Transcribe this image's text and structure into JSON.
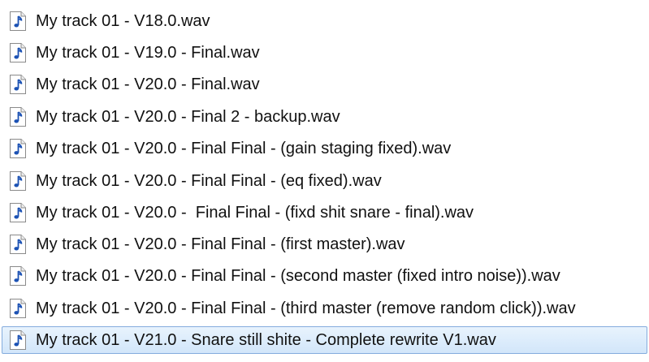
{
  "file_list": {
    "icon": "audio-file-icon",
    "colors": {
      "icon_note": "#1c52b4",
      "selection_fill": "#d9eafb",
      "selection_border": "#84acdd"
    },
    "items": [
      {
        "name": "My track 01 - V18.0.wav",
        "selected": false
      },
      {
        "name": "My track 01 - V19.0 - Final.wav",
        "selected": false
      },
      {
        "name": "My track 01 - V20.0 - Final.wav",
        "selected": false
      },
      {
        "name": "My track 01 - V20.0 - Final 2 - backup.wav",
        "selected": false
      },
      {
        "name": "My track 01 - V20.0 - Final Final - (gain staging fixed).wav",
        "selected": false
      },
      {
        "name": "My track 01 - V20.0 - Final Final - (eq fixed).wav",
        "selected": false
      },
      {
        "name": "My track 01 - V20.0 -  Final Final - (fixd shit snare - final).wav",
        "selected": false
      },
      {
        "name": "My track 01 - V20.0 - Final Final - (first master).wav",
        "selected": false
      },
      {
        "name": "My track 01 - V20.0 - Final Final - (second master (fixed intro noise)).wav",
        "selected": false
      },
      {
        "name": "My track 01 - V20.0 - Final Final - (third master (remove random click)).wav",
        "selected": false
      },
      {
        "name": "My track 01 - V21.0 - Snare still shite - Complete rewrite V1.wav",
        "selected": true
      }
    ]
  }
}
